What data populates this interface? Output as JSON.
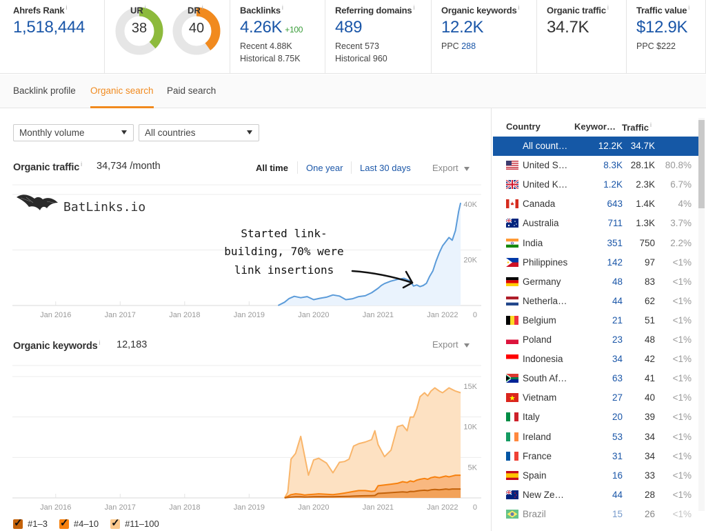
{
  "metrics": {
    "ahrefs_rank": {
      "label": "Ahrefs Rank",
      "info": "i",
      "value": "1,518,444"
    },
    "ur": {
      "label": "UR",
      "info": "i",
      "value": "38",
      "score": 38,
      "color": "#8dba3c"
    },
    "dr": {
      "label": "DR",
      "info": "i",
      "value": "40",
      "score": 40,
      "color": "#f18a1e"
    },
    "backlinks": {
      "label": "Backlinks",
      "info": "i",
      "value": "4.26K",
      "delta": "+100",
      "recent": "Recent 4.88K",
      "historical": "Historical 8.75K"
    },
    "referring_domains": {
      "label": "Referring domains",
      "info": "i",
      "value": "489",
      "recent": "Recent 573",
      "historical": "Historical 960"
    },
    "organic_keywords": {
      "label": "Organic keywords",
      "info": "i",
      "value": "12.2K",
      "ppc_label": "PPC",
      "ppc_value": "288"
    },
    "organic_traffic": {
      "label": "Organic traffic",
      "info": "i",
      "value": "34.7K"
    },
    "traffic_value": {
      "label": "Traffic value",
      "info": "i",
      "value": "$12.9K",
      "ppc": "PPC $222"
    }
  },
  "tabs": [
    {
      "label": "Backlink profile",
      "active": false
    },
    {
      "label": "Organic search",
      "active": true
    },
    {
      "label": "Paid search",
      "active": false
    }
  ],
  "filters": {
    "volume": {
      "selected": "Monthly volume",
      "icon": "caret-down-icon"
    },
    "country": {
      "selected": "All countries",
      "icon": "caret-down-icon"
    }
  },
  "traffic_section": {
    "title": "Organic traffic",
    "info": "i",
    "value": "34,734 /month",
    "ranges": [
      "All time",
      "One year",
      "Last 30 days"
    ],
    "active_range": "All time",
    "export_label": "Export",
    "watermark": "BatLinks.io",
    "annotation": [
      "Started link-",
      "building, 70% were",
      "link insertions"
    ]
  },
  "keywords_section": {
    "title": "Organic keywords",
    "info": "i",
    "value": "12,183",
    "export_label": "Export"
  },
  "chart_data": [
    {
      "type": "area",
      "title": "Organic traffic",
      "xlabel": "",
      "ylabel": "",
      "x_ticks": [
        "Jan 2016",
        "Jan 2017",
        "Jan 2018",
        "Jan 2019",
        "Jan 2020",
        "Jan 2021",
        "Jan 2022"
      ],
      "y_ticks": [
        "0",
        "20K",
        "40K"
      ],
      "ylim": [
        0,
        40000
      ],
      "xlim": [
        2015.35,
        2022.6
      ],
      "grid": true,
      "color": "#5b9bd9",
      "fill": "#eaf3fd",
      "series": [
        {
          "name": "Organic traffic",
          "x": [
            2019.45,
            2019.55,
            2019.62,
            2019.7,
            2019.8,
            2019.9,
            2020.0,
            2020.1,
            2020.2,
            2020.3,
            2020.4,
            2020.5,
            2020.6,
            2020.7,
            2020.8,
            2020.9,
            2021.0,
            2021.05,
            2021.1,
            2021.2,
            2021.3,
            2021.4,
            2021.5,
            2021.55,
            2021.6,
            2021.65,
            2021.7,
            2021.75,
            2021.8,
            2021.85,
            2021.9,
            2021.95,
            2022.0,
            2022.05,
            2022.1,
            2022.15,
            2022.2,
            2022.25,
            2022.28
          ],
          "values": [
            0,
            1200,
            2500,
            3300,
            2800,
            3200,
            2100,
            2600,
            3000,
            3800,
            3400,
            2100,
            2400,
            3200,
            3500,
            4600,
            6200,
            7200,
            7900,
            8800,
            9400,
            9800,
            8800,
            7000,
            7400,
            6800,
            7200,
            8000,
            10500,
            12500,
            16000,
            19000,
            21500,
            23000,
            24500,
            23500,
            27000,
            34000,
            37000
          ]
        }
      ]
    },
    {
      "type": "area",
      "title": "Organic keywords",
      "xlabel": "",
      "ylabel": "",
      "x_ticks": [
        "Jan 2016",
        "Jan 2017",
        "Jan 2018",
        "Jan 2019",
        "Jan 2020",
        "Jan 2021",
        "Jan 2022"
      ],
      "y_ticks": [
        "0",
        "5K",
        "10K",
        "15K"
      ],
      "ylim": [
        0,
        15000
      ],
      "xlim": [
        2015.35,
        2022.6
      ],
      "grid": true,
      "legend": "bottom-left",
      "x": [
        2019.55,
        2019.6,
        2019.65,
        2019.72,
        2019.8,
        2019.86,
        2019.92,
        2020.0,
        2020.08,
        2020.2,
        2020.3,
        2020.4,
        2020.48,
        2020.55,
        2020.62,
        2020.7,
        2020.8,
        2020.9,
        2020.95,
        2021.0,
        2021.1,
        2021.2,
        2021.3,
        2021.38,
        2021.45,
        2021.5,
        2021.55,
        2021.6,
        2021.65,
        2021.72,
        2021.77,
        2021.82,
        2021.88,
        2021.95,
        2022.0,
        2022.05,
        2022.1,
        2022.15,
        2022.2,
        2022.28
      ],
      "series": [
        {
          "name": "#11–100",
          "color": "#f9b56a",
          "fill": "#fde1c2",
          "values": [
            0,
            700,
            4800,
            5500,
            7600,
            5200,
            2800,
            4700,
            4900,
            4300,
            3100,
            4400,
            4500,
            4800,
            6400,
            6700,
            6900,
            7200,
            8300,
            6600,
            5100,
            5900,
            8800,
            9000,
            8300,
            10000,
            10000,
            11000,
            12500,
            13000,
            12600,
            13200,
            13600,
            13200,
            13000,
            13300,
            13600,
            13400,
            13200,
            13000
          ]
        },
        {
          "name": "#4–10",
          "color": "#f7810e",
          "fill": "#f9b880",
          "values": [
            0,
            200,
            400,
            500,
            450,
            350,
            400,
            450,
            500,
            450,
            400,
            500,
            600,
            700,
            800,
            900,
            900,
            800,
            850,
            1500,
            1600,
            1700,
            1800,
            2000,
            1900,
            2100,
            2000,
            2200,
            2300,
            2400,
            2300,
            2500,
            2600,
            2500,
            2600,
            2700,
            2600,
            2700,
            2800,
            2800
          ]
        },
        {
          "name": "#1–3",
          "color": "#c4620a",
          "fill": "#f2a25a",
          "values": [
            0,
            50,
            100,
            150,
            150,
            120,
            130,
            150,
            160,
            150,
            150,
            170,
            180,
            200,
            220,
            250,
            260,
            280,
            300,
            550,
            600,
            650,
            700,
            750,
            700,
            800,
            780,
            850,
            900,
            950,
            900,
            1000,
            1050,
            1000,
            1050,
            1100,
            1050,
            1100,
            1100,
            1100
          ]
        }
      ]
    }
  ],
  "legend": [
    {
      "label": "#1–3",
      "color": "#c4620a",
      "checked": true
    },
    {
      "label": "#4–10",
      "color": "#f7810e",
      "checked": true
    },
    {
      "label": "#11–100",
      "color": "#fcc98d",
      "checked": true
    }
  ],
  "country_table": {
    "headers": {
      "country": "Country",
      "keywords": "Keywor…",
      "traffic": "Traffic",
      "traffic_info": "i"
    },
    "rows": [
      {
        "name": "All count…",
        "keywords": "12.2K",
        "traffic": "34.7K",
        "share": "",
        "flag": "none",
        "selected": true
      },
      {
        "name": "United S…",
        "keywords": "8.3K",
        "traffic": "28.1K",
        "share": "80.8%",
        "flag": "us"
      },
      {
        "name": "United K…",
        "keywords": "1.2K",
        "traffic": "2.3K",
        "share": "6.7%",
        "flag": "gb"
      },
      {
        "name": "Canada",
        "keywords": "643",
        "traffic": "1.4K",
        "share": "4%",
        "flag": "ca"
      },
      {
        "name": "Australia",
        "keywords": "711",
        "traffic": "1.3K",
        "share": "3.7%",
        "flag": "au"
      },
      {
        "name": "India",
        "keywords": "351",
        "traffic": "750",
        "share": "2.2%",
        "flag": "in"
      },
      {
        "name": "Philippines",
        "keywords": "142",
        "traffic": "97",
        "share": "<1%",
        "flag": "ph"
      },
      {
        "name": "Germany",
        "keywords": "48",
        "traffic": "83",
        "share": "<1%",
        "flag": "de"
      },
      {
        "name": "Netherla…",
        "keywords": "44",
        "traffic": "62",
        "share": "<1%",
        "flag": "nl"
      },
      {
        "name": "Belgium",
        "keywords": "21",
        "traffic": "51",
        "share": "<1%",
        "flag": "be"
      },
      {
        "name": "Poland",
        "keywords": "23",
        "traffic": "48",
        "share": "<1%",
        "flag": "pl"
      },
      {
        "name": "Indonesia",
        "keywords": "34",
        "traffic": "42",
        "share": "<1%",
        "flag": "id"
      },
      {
        "name": "South Af…",
        "keywords": "63",
        "traffic": "41",
        "share": "<1%",
        "flag": "za"
      },
      {
        "name": "Vietnam",
        "keywords": "27",
        "traffic": "40",
        "share": "<1%",
        "flag": "vn"
      },
      {
        "name": "Italy",
        "keywords": "20",
        "traffic": "39",
        "share": "<1%",
        "flag": "it"
      },
      {
        "name": "Ireland",
        "keywords": "53",
        "traffic": "34",
        "share": "<1%",
        "flag": "ie"
      },
      {
        "name": "France",
        "keywords": "31",
        "traffic": "34",
        "share": "<1%",
        "flag": "fr"
      },
      {
        "name": "Spain",
        "keywords": "16",
        "traffic": "33",
        "share": "<1%",
        "flag": "es"
      },
      {
        "name": "New Ze…",
        "keywords": "44",
        "traffic": "28",
        "share": "<1%",
        "flag": "nz"
      },
      {
        "name": "Brazil",
        "keywords": "15",
        "traffic": "26",
        "share": "<1%",
        "flag": "br",
        "faded": true
      }
    ]
  }
}
